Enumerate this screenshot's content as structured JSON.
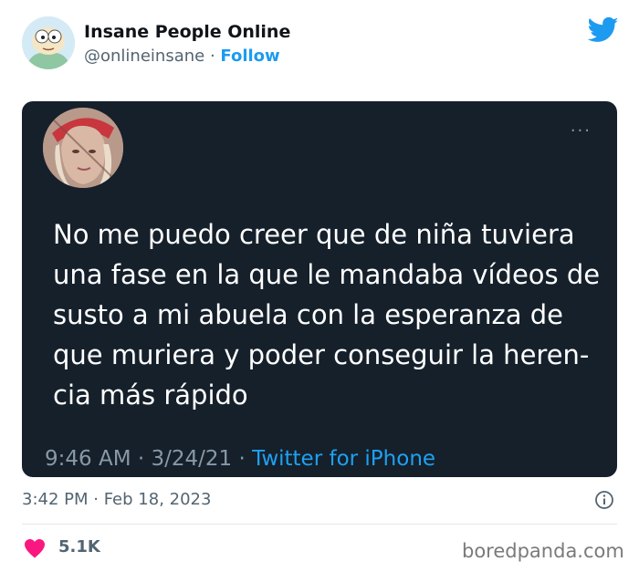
{
  "author": {
    "name": "Insane People Online",
    "handle": "@onlineinsane",
    "separator": " · ",
    "follow_label": "Follow",
    "avatar_icon": "cartoon-character-avatar"
  },
  "embedded_tweet": {
    "text": "No me puedo creer que de niña tuviera\nuna fase en la que le mandaba vídeos de\nsusto a mi abuela con la esperanza de\nque muriera y poder conseguir la heren-\ncia más rápido",
    "time": "9:46 AM · 3/24/21 · ",
    "source": "Twitter for iPhone",
    "more_label": "···",
    "background": "#15202b"
  },
  "post": {
    "timestamp": "3:42 PM · Feb 18, 2023",
    "likes": "5.1K"
  },
  "watermark": "boredpanda.com",
  "colors": {
    "accent": "#1d9bf0",
    "heart": "#f91880",
    "text_primary": "#0f1419",
    "text_secondary": "#536471"
  }
}
